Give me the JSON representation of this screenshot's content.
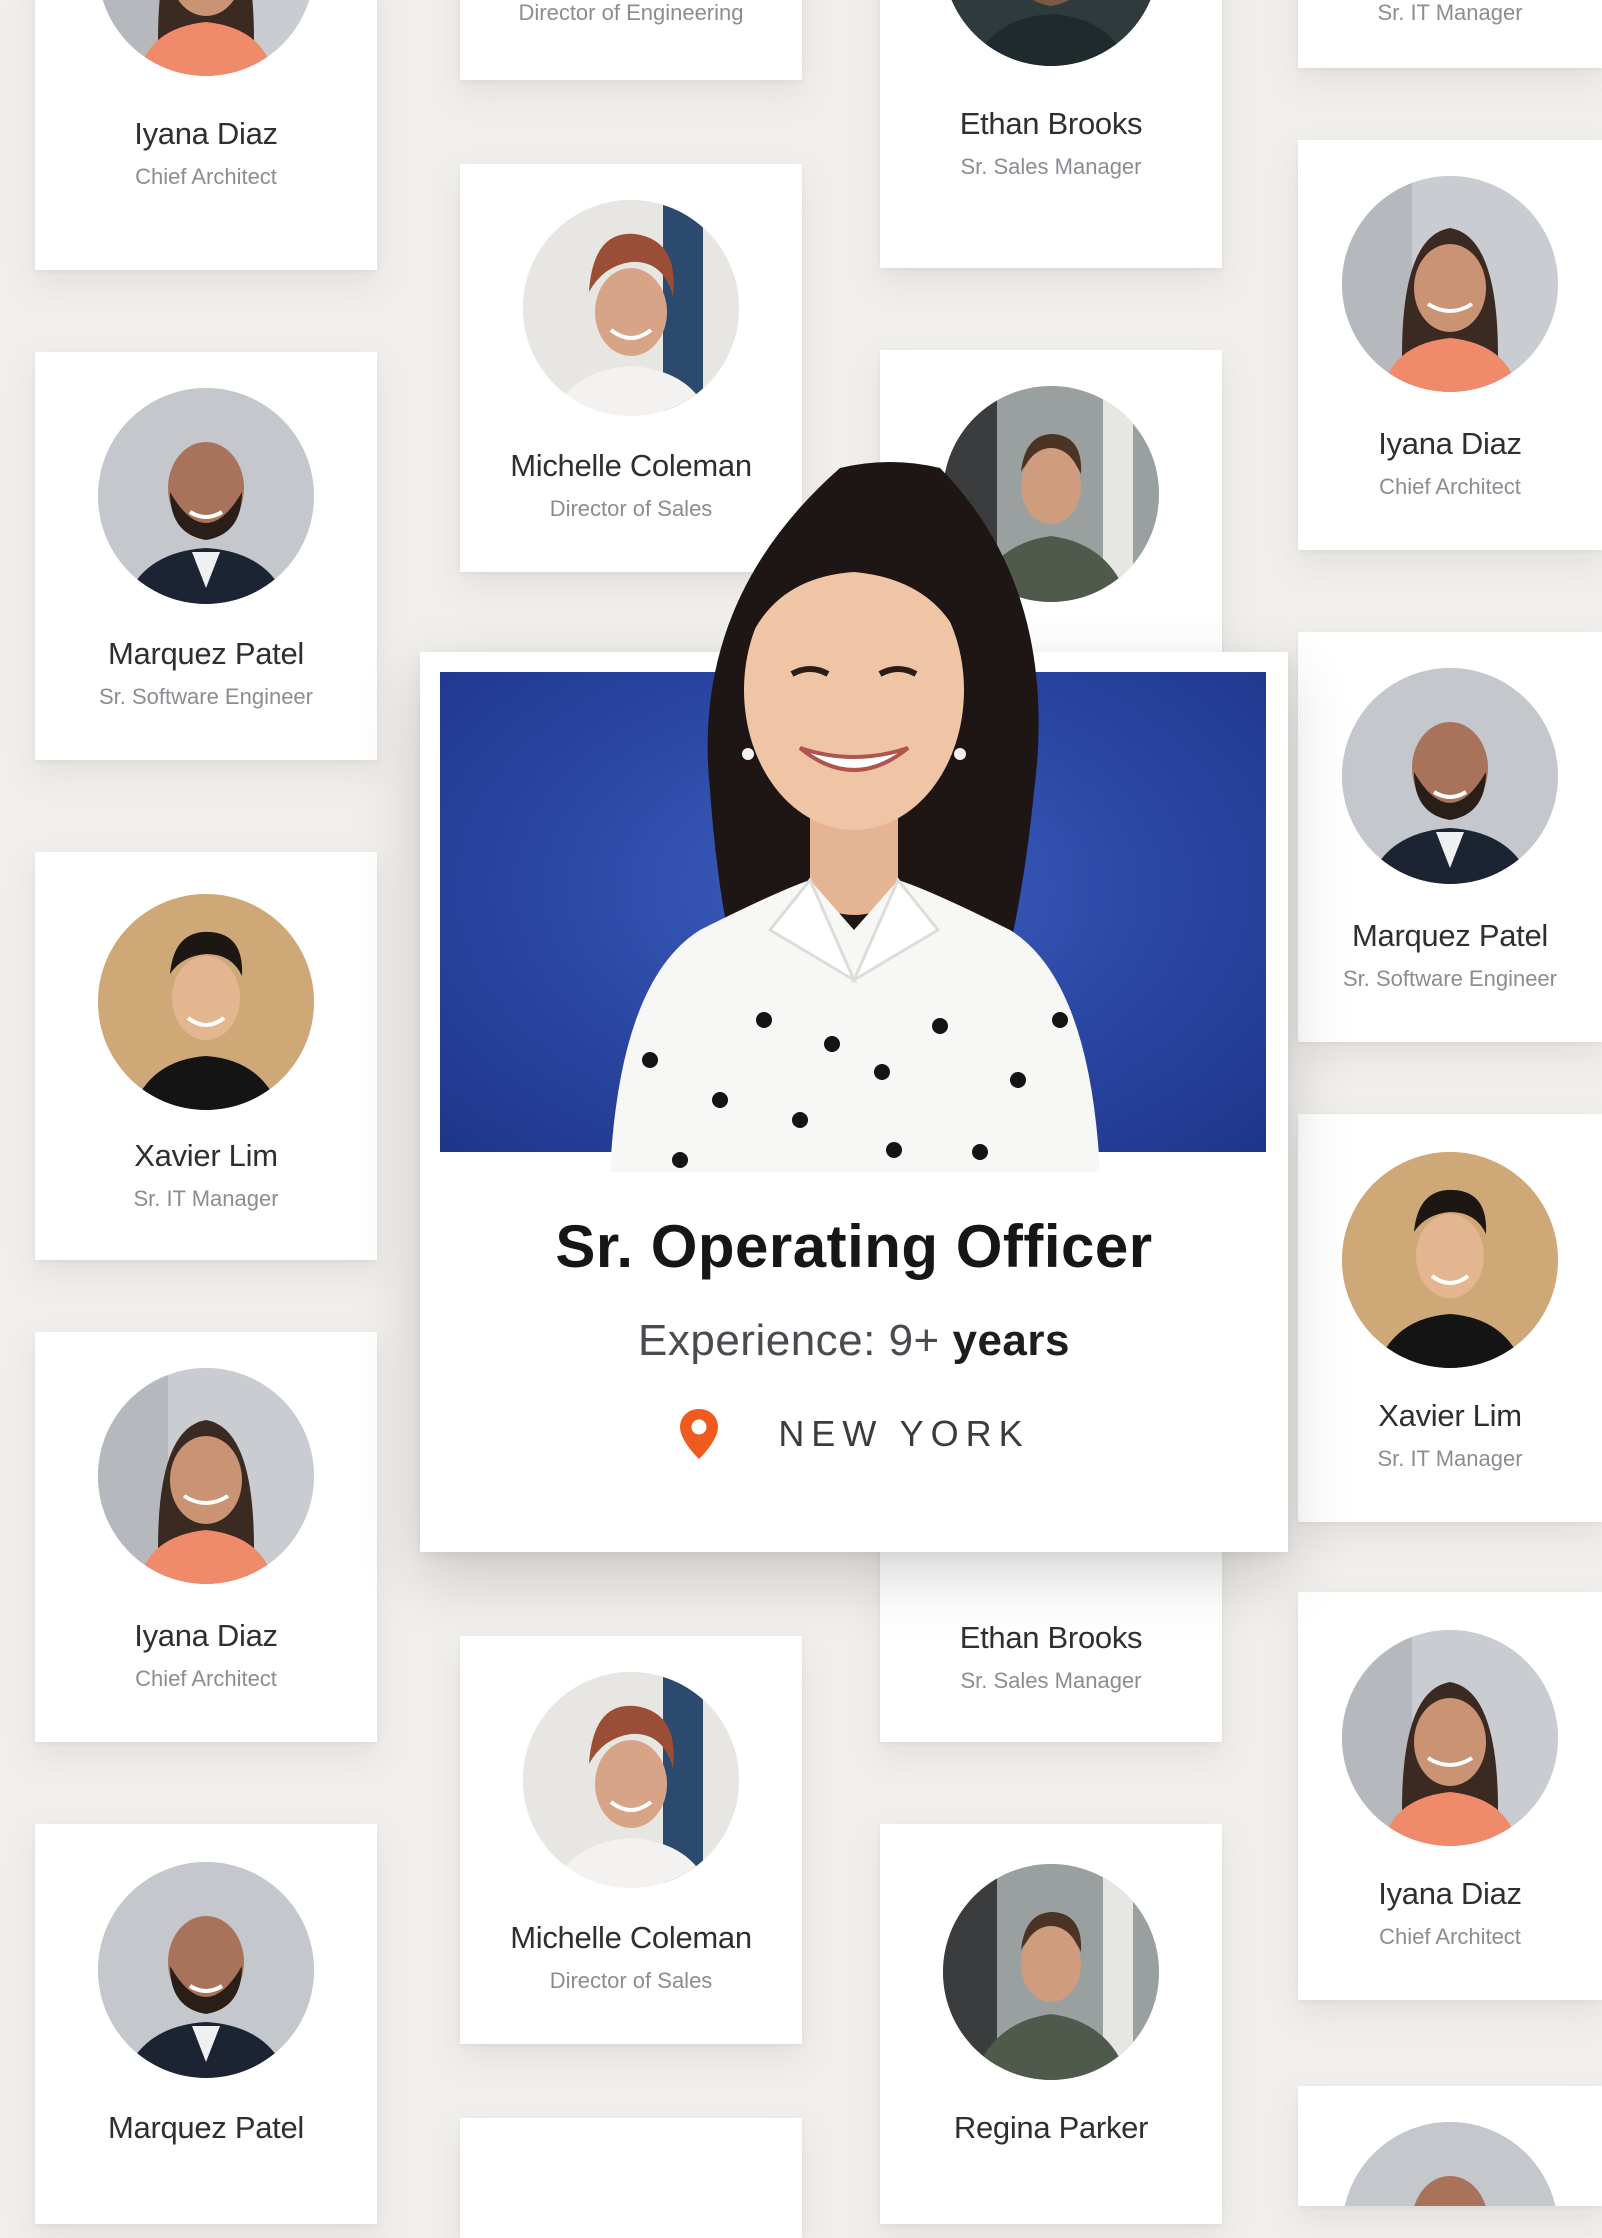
{
  "featured": {
    "title": "Sr. Operating Officer",
    "experience_label": "Experience: 9+",
    "experience_unit": "years",
    "location": "NEW YORK",
    "location_icon": "map-pin-icon",
    "accent_color": "#ef5b1e",
    "photo_bg_color": "#2a46a3"
  },
  "cards": [
    {
      "name": "Iyana Diaz",
      "role": "Chief Architect"
    },
    {
      "name": "",
      "role": "Director of Engineering"
    },
    {
      "name": "Ethan Brooks",
      "role": "Sr. Sales Manager"
    },
    {
      "name": "",
      "role": "Sr. IT Manager"
    },
    {
      "name": "Michelle Coleman",
      "role": "Director of Sales"
    },
    {
      "name": "Iyana Diaz",
      "role": "Chief Architect"
    },
    {
      "name": "Marquez Patel",
      "role": "Sr. Software Engineer"
    },
    {
      "name": "Marquez Patel",
      "role": "Sr. Software Engineer"
    },
    {
      "name": "Xavier Lim",
      "role": "Sr. IT Manager"
    },
    {
      "name": "Xavier Lim",
      "role": "Sr. IT Manager"
    },
    {
      "name": "Iyana Diaz",
      "role": "Chief Architect"
    },
    {
      "name": "Ethan Brooks",
      "role": "Sr. Sales Manager"
    },
    {
      "name": "Michelle Coleman",
      "role": "Director of Sales"
    },
    {
      "name": "Iyana Diaz",
      "role": "Chief Architect"
    },
    {
      "name": "Marquez Patel",
      "role": ""
    },
    {
      "name": "Regina Parker",
      "role": ""
    }
  ]
}
